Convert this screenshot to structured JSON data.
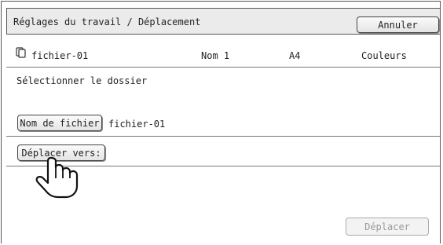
{
  "header": {
    "title": "Réglages du travail / Déplacement",
    "cancel_label": "Annuler"
  },
  "file_info": {
    "icon": "file-copies-icon",
    "name": "fichier-01",
    "user": "Nom 1",
    "paper": "A4",
    "color_mode": "Couleurs"
  },
  "main": {
    "folder_prompt": "Sélectionner le dossier",
    "file_name_button": "Nom de fichier",
    "file_name_value": "fichier-01",
    "move_to_button": "Déplacer vers:",
    "pointer_icon": "hand-pointer-icon",
    "move_button": "Déplacer"
  }
}
